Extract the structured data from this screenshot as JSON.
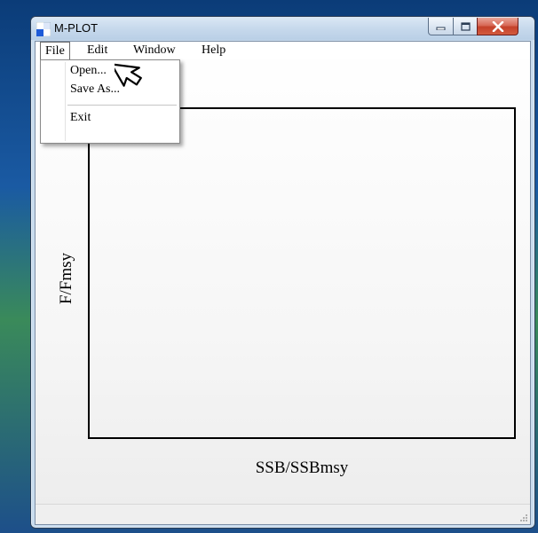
{
  "window": {
    "title": "M-PLOT",
    "controls": {
      "minimize": "minimize",
      "maximize": "maximize",
      "close": "close"
    }
  },
  "menubar": {
    "items": [
      {
        "label": "File",
        "open": true
      },
      {
        "label": "Edit"
      },
      {
        "label": "Window"
      },
      {
        "label": "Help"
      }
    ]
  },
  "file_menu": {
    "items": [
      {
        "label": "Open..."
      },
      {
        "label": "Save As..."
      },
      {
        "label": "Exit"
      }
    ]
  },
  "plot": {
    "xlabel": "SSB/SSBmsy",
    "ylabel": "F/Fmsy"
  },
  "colors": {
    "title_bar": "#c7d9ec",
    "close_button": "#c4402a",
    "plot_border": "#000000"
  },
  "icons": [
    "app-icon",
    "minimize-icon",
    "maximize-icon",
    "close-icon",
    "mouse-cursor-icon",
    "resize-grip-icon"
  ]
}
